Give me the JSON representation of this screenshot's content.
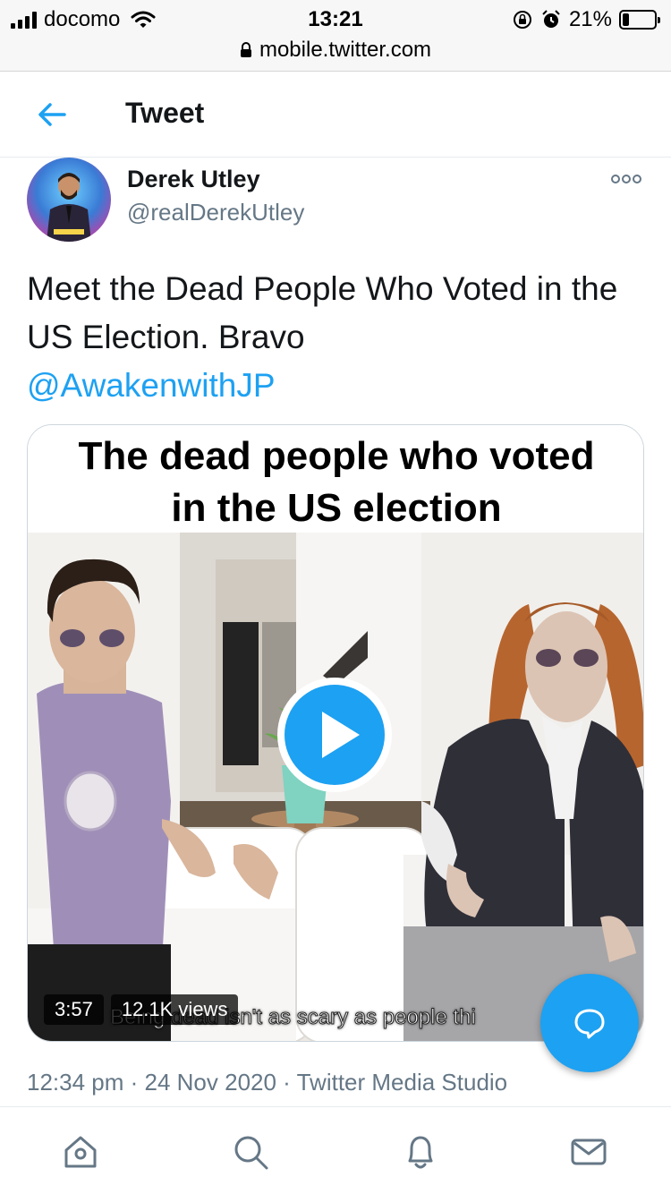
{
  "status_bar": {
    "carrier": "docomo",
    "time": "13:21",
    "url": "mobile.twitter.com",
    "battery": "21%",
    "battery_level": 0.21
  },
  "header": {
    "title": "Tweet"
  },
  "tweet": {
    "author_name": "Derek Utley",
    "author_handle": "@realDerekUtley",
    "text": "Meet the Dead People Who Voted in the US Election. Bravo",
    "mention": "@AwakenwithJP",
    "media": {
      "caption_line1": "The dead people who voted",
      "caption_line2": "in the US election",
      "duration": "3:57",
      "views": "12.1K views",
      "subtitle": "Being dead isn't as scary as people thi"
    },
    "timestamp": "12:34 pm · 24 Nov 2020 · Twitter Media Studio"
  },
  "colors": {
    "accent": "#1da1f2",
    "text": "#14171a",
    "muted": "#657786"
  },
  "nav": {
    "items": [
      "home-icon",
      "search-icon",
      "notifications-icon",
      "messages-icon"
    ]
  }
}
